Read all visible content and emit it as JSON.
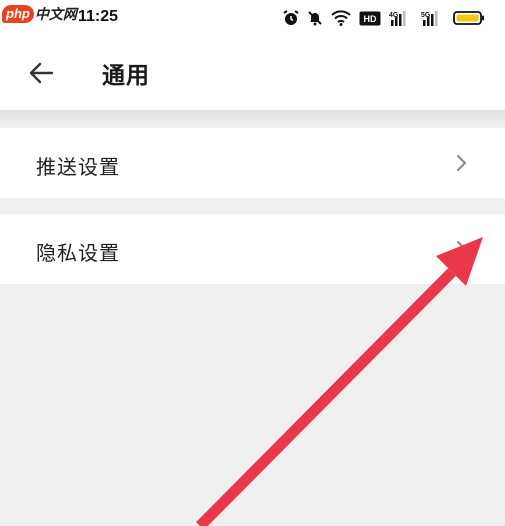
{
  "status_bar": {
    "logo_mark": "php",
    "logo_text": "中文网",
    "time": "11:25",
    "icons": [
      "alarm-icon",
      "mute-icon",
      "wifi-icon",
      "hd-icon",
      "signal-4g-icon",
      "signal-5g-icon",
      "battery-icon"
    ],
    "signal_labels": [
      "4G",
      "5G"
    ],
    "hd_label": "HD",
    "battery_color": "#f5c518"
  },
  "app_bar": {
    "back_icon": "back-arrow-icon",
    "title": "通用"
  },
  "settings": [
    {
      "label": "推送设置",
      "icon": "chevron-right-icon"
    },
    {
      "label": "隐私设置",
      "icon": "chevron-right-icon"
    }
  ],
  "annotation": {
    "color": "#e8384a"
  }
}
